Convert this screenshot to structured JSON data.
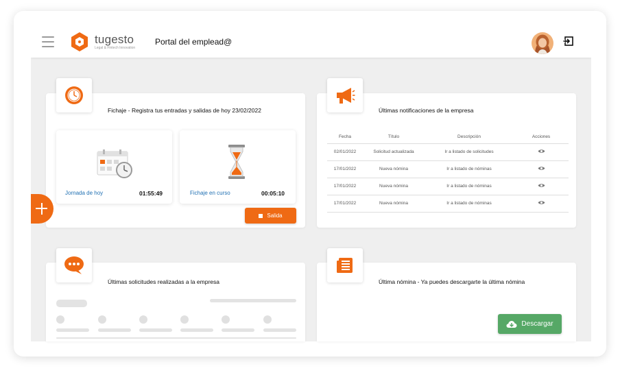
{
  "header": {
    "brand": "tugesto",
    "tagline": "Legal & Fintech Innovation",
    "portal_title": "Portal del emplead@"
  },
  "fichaje": {
    "title": "Fichaje - Registra tus entradas y salidas de hoy 23/02/2022",
    "jornada_label": "Jornada de hoy",
    "jornada_time": "01:55:49",
    "curso_label": "Fichaje en curso",
    "curso_time": "00:05:10",
    "salida_label": "Salida"
  },
  "notificaciones": {
    "title": "Últimas notificaciones de la empresa",
    "columns": [
      "Fecha",
      "Título",
      "Descripción",
      "Acciones"
    ],
    "rows": [
      {
        "fecha": "02/01/2022",
        "titulo": "Solicitud actualizada",
        "descripcion": "Ir a listado de solicitudes"
      },
      {
        "fecha": "17/01/2022",
        "titulo": "Nueva nómina",
        "descripcion": "Ir a listado de nóminas"
      },
      {
        "fecha": "17/01/2022",
        "titulo": "Nueva nómina",
        "descripcion": "Ir a listado de nóminas"
      },
      {
        "fecha": "17/01/2022",
        "titulo": "Nueva nómina",
        "descripcion": "Ir a listado de nóminas"
      }
    ]
  },
  "solicitudes": {
    "title": "Últimas solicitudes realizadas a la empresa"
  },
  "nomina": {
    "title": "Última nómina - Ya puedes descargarte la última nómina",
    "download_label": "Descargar"
  },
  "colors": {
    "accent": "#ef6a14",
    "success": "#56a866",
    "link": "#1f6fb2",
    "background": "#efefef"
  },
  "icons": {
    "menu": "hamburger-icon",
    "logout": "logout-icon",
    "fichaje": "clock-icon",
    "notificaciones": "megaphone-icon",
    "solicitudes": "chat-bubble-icon",
    "nomina": "document-icon",
    "jornada": "calendar-clock-icon",
    "curso": "hourglass-icon",
    "accion": "eye-icon",
    "fab": "plus-icon",
    "descargar": "cloud-download-icon"
  }
}
